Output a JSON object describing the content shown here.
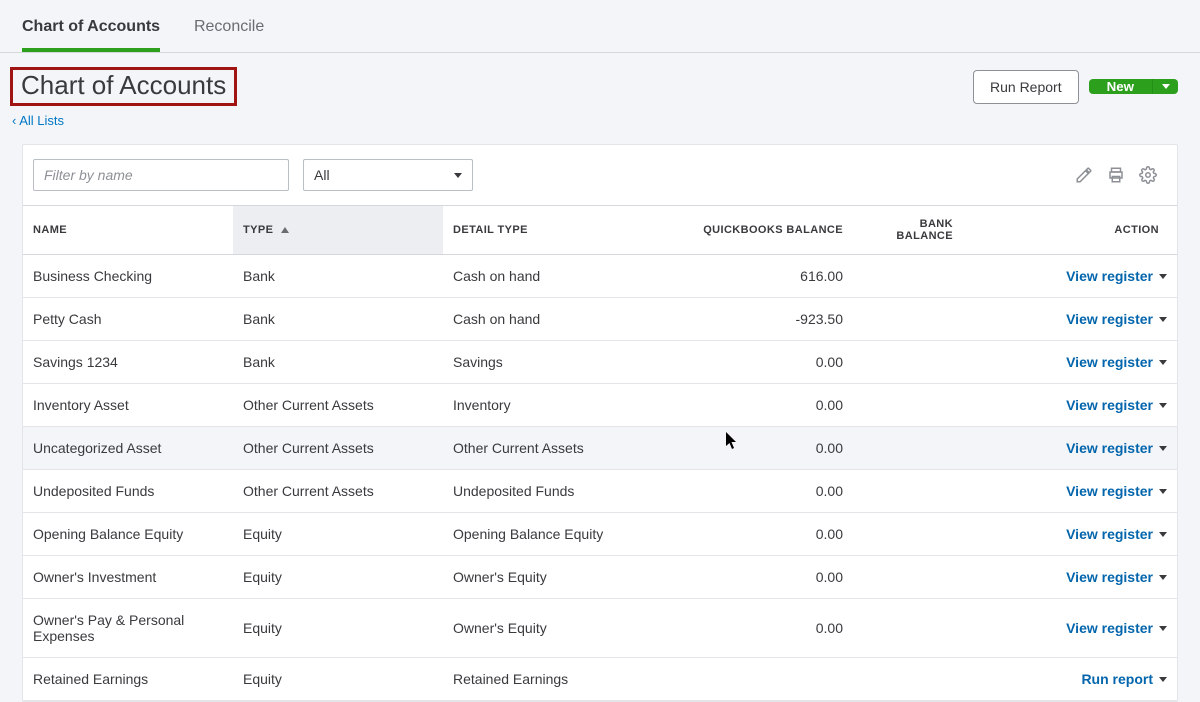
{
  "tabs": {
    "chart": "Chart of Accounts",
    "reconcile": "Reconcile"
  },
  "page_title": "Chart of Accounts",
  "all_lists": {
    "chevron": "‹",
    "label": "All Lists"
  },
  "buttons": {
    "run_report": "Run Report",
    "new": "New"
  },
  "filter": {
    "placeholder": "Filter by name",
    "type_value": "All"
  },
  "columns": {
    "name": "NAME",
    "type": "TYPE",
    "detail_type": "DETAIL TYPE",
    "qb_balance": "QUICKBOOKS BALANCE",
    "bank_balance": "BANK BALANCE",
    "action": "ACTION"
  },
  "action_labels": {
    "view_register": "View register",
    "run_report": "Run report"
  },
  "rows": [
    {
      "name": "Business Checking",
      "type": "Bank",
      "detail": "Cash on hand",
      "qb": "616.00",
      "bank": "",
      "action": "view_register"
    },
    {
      "name": "Petty Cash",
      "type": "Bank",
      "detail": "Cash on hand",
      "qb": "-923.50",
      "bank": "",
      "action": "view_register"
    },
    {
      "name": "Savings 1234",
      "type": "Bank",
      "detail": "Savings",
      "qb": "0.00",
      "bank": "",
      "action": "view_register"
    },
    {
      "name": "Inventory Asset",
      "type": "Other Current Assets",
      "detail": "Inventory",
      "qb": "0.00",
      "bank": "",
      "action": "view_register"
    },
    {
      "name": "Uncategorized Asset",
      "type": "Other Current Assets",
      "detail": "Other Current Assets",
      "qb": "0.00",
      "bank": "",
      "action": "view_register",
      "hover": true
    },
    {
      "name": "Undeposited Funds",
      "type": "Other Current Assets",
      "detail": "Undeposited Funds",
      "qb": "0.00",
      "bank": "",
      "action": "view_register"
    },
    {
      "name": "Opening Balance Equity",
      "type": "Equity",
      "detail": "Opening Balance Equity",
      "qb": "0.00",
      "bank": "",
      "action": "view_register"
    },
    {
      "name": "Owner's Investment",
      "type": "Equity",
      "detail": "Owner's Equity",
      "qb": "0.00",
      "bank": "",
      "action": "view_register"
    },
    {
      "name": "Owner's Pay & Personal Expenses",
      "type": "Equity",
      "detail": "Owner's Equity",
      "qb": "0.00",
      "bank": "",
      "action": "view_register"
    },
    {
      "name": "Retained Earnings",
      "type": "Equity",
      "detail": "Retained Earnings",
      "qb": "",
      "bank": "",
      "action": "run_report"
    }
  ]
}
